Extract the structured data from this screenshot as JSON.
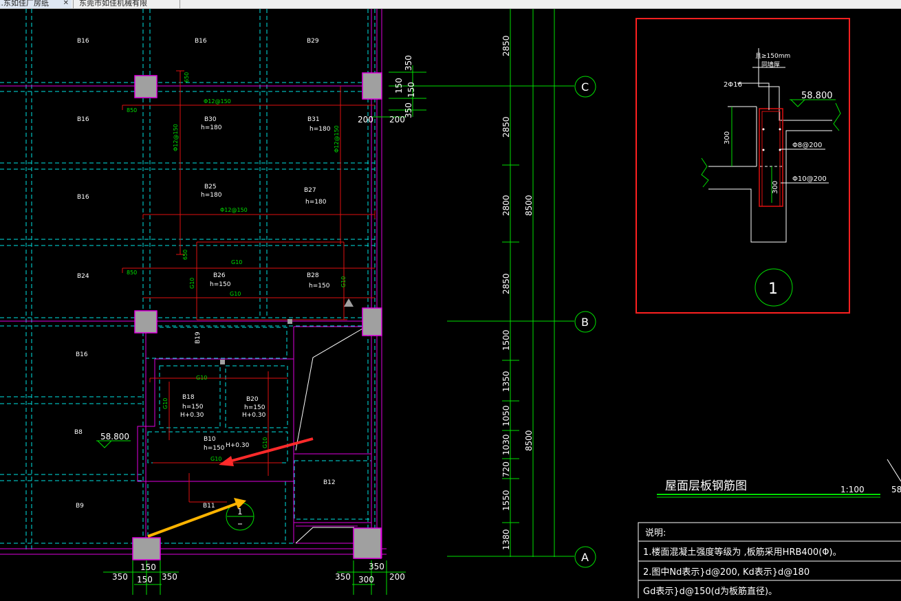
{
  "tabs": [
    {
      "label": "…东如佳厂房纸",
      "active": true
    },
    {
      "label": "东莞市如佳机械有限",
      "active": false
    }
  ],
  "grid": {
    "axis_C": "C",
    "axis_B": "B",
    "axis_A": "A",
    "dims_upper": [
      "2850",
      "2850",
      "2800",
      "2850"
    ],
    "dim_total_upper": "8500",
    "dims_lower": [
      "1500",
      "1350",
      "1050",
      "1030",
      "720",
      "1550",
      "1380"
    ],
    "dim_total_lower": "8500",
    "col_top_dims": [
      "350",
      "150",
      "150",
      "350"
    ],
    "side_200_a": "200",
    "side_200_b": "200",
    "bottom_dims_left": [
      "350",
      "150",
      "150",
      "350"
    ],
    "bottom_dims_right": [
      "350",
      "300",
      "350",
      "200"
    ]
  },
  "slabs": {
    "B16_a": "B16",
    "B16_b": "B16",
    "B29": "B29",
    "B16_c": "B16",
    "B30": "B30",
    "B31": "B31",
    "B16_d": "B16",
    "B25": "B25",
    "B27": "B27",
    "B24": "B24",
    "B26": "B26",
    "B28": "B28",
    "B16_e": "B16",
    "B18": "B18",
    "B20": "B20",
    "B8": "B8",
    "B10": "B10",
    "B12": "B12",
    "B9": "B9",
    "B11": "B11",
    "B19": "B19",
    "h180": "h=180",
    "h150": "h=150",
    "hH030": "H+0.30",
    "rebar_12_150": "Φ12@150",
    "g10": "G10",
    "d650": "650",
    "d850": "850",
    "level_left": "58.800",
    "detail_circle_num": "1"
  },
  "detail": {
    "note_h": "且≥150mm",
    "note_wall": "同墙厚",
    "bar_top": "2Φ16",
    "level": "58.800",
    "dim_300a": "300",
    "dim_300b": "300",
    "stirrup": "Φ8@200",
    "dist": "Φ10@200",
    "label_num": "1"
  },
  "title_block": {
    "title": "屋面层板钢筋图",
    "scale": "1:100",
    "edge_num": "58"
  },
  "notes": {
    "heading": "说明:",
    "line1": "1.楼面混凝土强度等级为   ,板筋采用HRB400(Φ)。",
    "line2": "2.图中Nd表示}d@200, Kd表示}d@180",
    "line3": "   Gd表示}d@150(d为板筋直径)。"
  },
  "colors": {
    "cyan": "#00e5e5",
    "magenta": "#e000e0",
    "green": "#00e000",
    "red": "#e01010",
    "white": "#ffffff",
    "gray": "#a0a0a0",
    "frame_red": "#ff2020",
    "arrow_red": "#ff2a2a",
    "arrow_yellow": "#ffb400"
  }
}
